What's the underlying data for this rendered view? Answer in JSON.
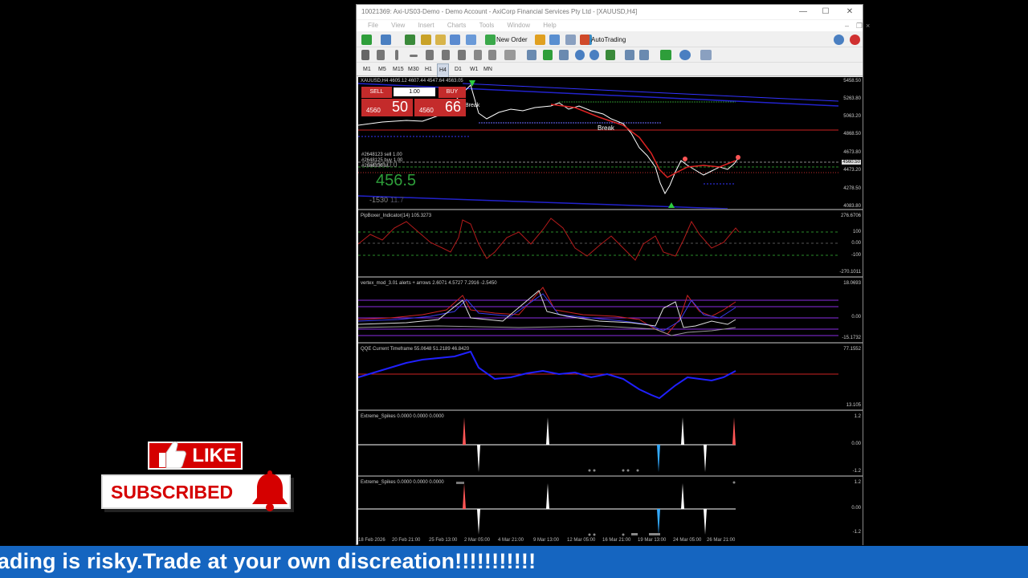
{
  "window": {
    "title": "10021369: Axi-US03-Demo - Demo Account - AxiCorp Financial Services Pty Ltd - [XAUUSD,H4]",
    "minimize": "—",
    "maximize": "☐",
    "close": "✕"
  },
  "menu": [
    "File",
    "View",
    "Insert",
    "Charts",
    "Tools",
    "Window",
    "Help"
  ],
  "toolbar": {
    "new_order": "New Order",
    "autotrading": "AutoTrading"
  },
  "timeframes": [
    "M1",
    "M5",
    "M15",
    "M30",
    "H1",
    "H4",
    "D1",
    "W1",
    "MN"
  ],
  "active_timeframe": "H4",
  "main_chart": {
    "label": "XAUUSD,H4  4605.12 4607.44 4547.64 4563.05",
    "price_scale": [
      "5458.50",
      "5263.80",
      "5063.20",
      "4868.50",
      "4673.80",
      "4560.50",
      "4473.20",
      "4278.50",
      "4083.80"
    ],
    "break_labels": [
      "Break",
      "Break"
    ],
    "info_lines": [
      "#2648123 sell 1.00",
      "#2648125 buy 1.00",
      "#2648130 sl"
    ],
    "short_text": "Short  0.0",
    "big_value": "456.5",
    "small_value": "-1530",
    "small_value2": "11.7",
    "accent": "#c42b2b"
  },
  "trade_panel": {
    "sell": "SELL",
    "buy": "BUY",
    "lot": "1.00",
    "sell_price_small": "4560",
    "sell_price_big": "50",
    "buy_price_small": "4560",
    "buy_price_big": "66"
  },
  "indicators": [
    {
      "label": "PipBoxer_Indicator(14) 105.3273",
      "scale": [
        "276.6706",
        "100",
        "0.00",
        "-100",
        "-270.1011"
      ]
    },
    {
      "label": "vertex_mod_3.01 alerts + arrows 2.6071 4.5727 7.2916 -2.5450",
      "scale": [
        "18.0693",
        "0.00",
        "-15.1732"
      ]
    },
    {
      "label": "QQE Current Timeframe 55.0648 51.2189 46.8420",
      "scale": [
        "77.1552",
        "13.105"
      ]
    },
    {
      "label": "Extreme_Spikes 0.0000 0.0000 0.0000",
      "scale": [
        "1.2",
        "0.00",
        "-1.2"
      ]
    },
    {
      "label": "Extreme_Spikes 0.0000 0.0000 0.0000",
      "scale": [
        "1.2",
        "0.00",
        "-1.2"
      ]
    }
  ],
  "time_axis": [
    "18 Feb 2026",
    "20 Feb 21:00",
    "25 Feb 13:00",
    "2 Mar 05:00",
    "4 Mar 21:00",
    "9 Mar 13:00",
    "12 Mar 05:00",
    "16 Mar 21:00",
    "19 Mar 13:00",
    "24 Mar 05:00",
    "26 Mar 21:00"
  ],
  "overlay": {
    "like": "LIKE",
    "subscribed": "SUBSCRIBED",
    "ticker": "rading is risky.Trade at your own discreation!!!!!!!!!!!"
  }
}
